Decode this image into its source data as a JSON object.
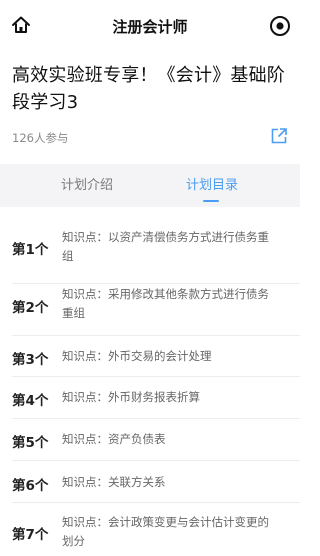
{
  "nav": {
    "title": "注册会计师"
  },
  "course": {
    "title": "高效实验班专享！《会计》基础阶段学习3",
    "participants": "126人参与"
  },
  "tabs": {
    "intro": "计划介绍",
    "catalog": "计划目录",
    "active": "计划目录"
  },
  "items": [
    {
      "num": "第1个",
      "text": "知识点：以资产清偿债务方式进行债务重组"
    },
    {
      "num": "第2个",
      "text": "知识点：采用修改其他条款方式进行债务重组"
    },
    {
      "num": "第3个",
      "text": "知识点：外币交易的会计处理"
    },
    {
      "num": "第4个",
      "text": "知识点：外币财务报表折算"
    },
    {
      "num": "第5个",
      "text": "知识点：资产负债表"
    },
    {
      "num": "第6个",
      "text": "知识点：关联方关系"
    },
    {
      "num": "第7个",
      "text": "知识点：会计政策变更与会计估计变更的划分"
    }
  ],
  "colors": {
    "accent": "#4a9df0",
    "tab_bar_bg": "#f4f4f6"
  },
  "icons": {
    "home": "home-icon",
    "capsule": "record-icon",
    "share": "share-icon"
  }
}
